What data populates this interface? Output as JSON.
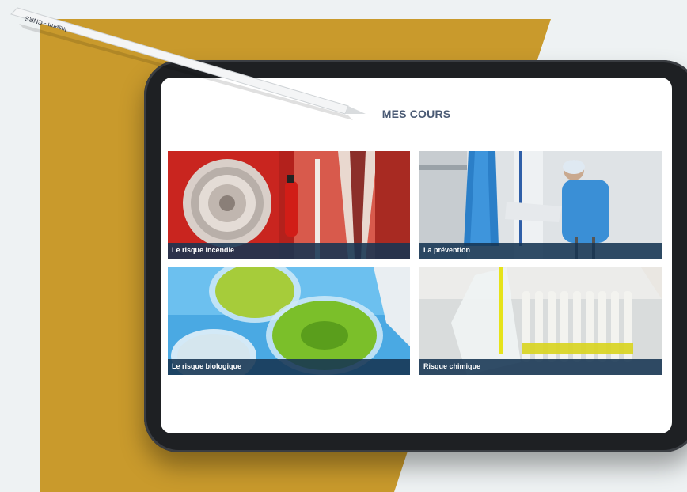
{
  "page": {
    "title": "MES COURS"
  },
  "stylus": {
    "engraving": "Inserm - CNRS"
  },
  "courses": [
    {
      "label": "Le risque incendie"
    },
    {
      "label": "La prévention"
    },
    {
      "label": "Le risque biologique"
    },
    {
      "label": "Risque chimique"
    }
  ],
  "colors": {
    "background": "#eef2f3",
    "accent_gold": "#c99a2c",
    "title": "#4a5a74",
    "caption_bar": "#163452",
    "tablet_frame": "#1e2023"
  }
}
